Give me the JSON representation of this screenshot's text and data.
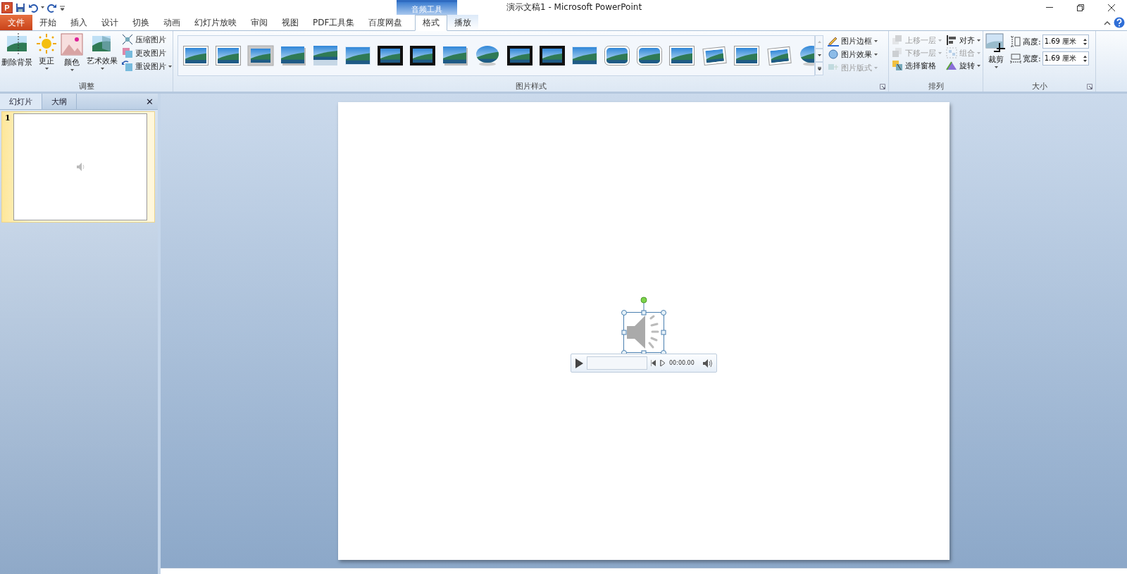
{
  "quick_access": {
    "app_badge": "P"
  },
  "window": {
    "title": "演示文稿1  -  Microsoft PowerPoint"
  },
  "contextual_tab_group": {
    "label": "音频工具"
  },
  "tabs": [
    {
      "label": "文件",
      "kind": "file",
      "selected": false
    },
    {
      "label": "开始",
      "kind": "normal",
      "selected": false
    },
    {
      "label": "插入",
      "kind": "normal",
      "selected": false
    },
    {
      "label": "设计",
      "kind": "normal",
      "selected": false
    },
    {
      "label": "切换",
      "kind": "normal",
      "selected": false
    },
    {
      "label": "动画",
      "kind": "normal",
      "selected": false
    },
    {
      "label": "幻灯片放映",
      "kind": "normal",
      "selected": false
    },
    {
      "label": "审阅",
      "kind": "normal",
      "selected": false
    },
    {
      "label": "视图",
      "kind": "normal",
      "selected": false
    },
    {
      "label": "PDF工具集",
      "kind": "normal",
      "selected": false
    },
    {
      "label": "百度网盘",
      "kind": "normal",
      "selected": false
    },
    {
      "label": "格式",
      "kind": "contextual",
      "selected": true
    },
    {
      "label": "播放",
      "kind": "contextual",
      "selected": false
    }
  ],
  "ribbon": {
    "adjust": {
      "label": "调整",
      "large_buttons": [
        {
          "label": "删除背景",
          "dropdown": false
        },
        {
          "label": "更正",
          "dropdown": true
        },
        {
          "label": "颜色",
          "dropdown": true
        },
        {
          "label": "艺术效果",
          "dropdown": true
        }
      ],
      "small_buttons": [
        {
          "label": "压缩图片",
          "dropdown": false
        },
        {
          "label": "更改图片",
          "dropdown": false
        },
        {
          "label": "重设图片",
          "dropdown": true
        }
      ]
    },
    "picture_styles": {
      "label": "图片样式",
      "gallery": [
        {
          "kind": "frame"
        },
        {
          "kind": "frame"
        },
        {
          "kind": "thick"
        },
        {
          "kind": "shadow"
        },
        {
          "kind": "reflection"
        },
        {
          "kind": "soft"
        },
        {
          "kind": "black"
        },
        {
          "kind": "black"
        },
        {
          "kind": "shadow"
        },
        {
          "kind": "oval"
        },
        {
          "kind": "black"
        },
        {
          "kind": "black"
        },
        {
          "kind": "soft"
        },
        {
          "kind": "rounded"
        },
        {
          "kind": "rounded"
        },
        {
          "kind": "frame"
        },
        {
          "kind": "tilted"
        },
        {
          "kind": "frame"
        },
        {
          "kind": "tilted"
        },
        {
          "kind": "oval"
        }
      ],
      "commands": [
        {
          "label": "图片边框",
          "disabled": false
        },
        {
          "label": "图片效果",
          "disabled": false
        },
        {
          "label": "图片版式",
          "disabled": true
        }
      ]
    },
    "arrange": {
      "label": "排列",
      "items": [
        {
          "label": "上移一层",
          "disabled": true,
          "dropdown": true
        },
        {
          "label": "对齐",
          "disabled": false,
          "dropdown": true
        },
        {
          "label": "下移一层",
          "disabled": true,
          "dropdown": true
        },
        {
          "label": "组合",
          "disabled": true,
          "dropdown": true
        },
        {
          "label": "选择窗格",
          "disabled": false,
          "dropdown": false
        },
        {
          "label": "旋转",
          "disabled": false,
          "dropdown": true
        }
      ]
    },
    "size": {
      "label": "大小",
      "crop": {
        "label": "裁剪"
      },
      "fields": [
        {
          "label": "高度:",
          "value": "1.69 厘米"
        },
        {
          "label": "宽度:",
          "value": "1.69 厘米"
        }
      ]
    }
  },
  "slides_pane": {
    "tabs": [
      {
        "label": "幻灯片",
        "selected": true
      },
      {
        "label": "大纲",
        "selected": false
      }
    ],
    "close": "✕",
    "thumbnails": [
      {
        "number": "1",
        "selected": true
      }
    ]
  },
  "media_player": {
    "time": "00:00.00"
  }
}
